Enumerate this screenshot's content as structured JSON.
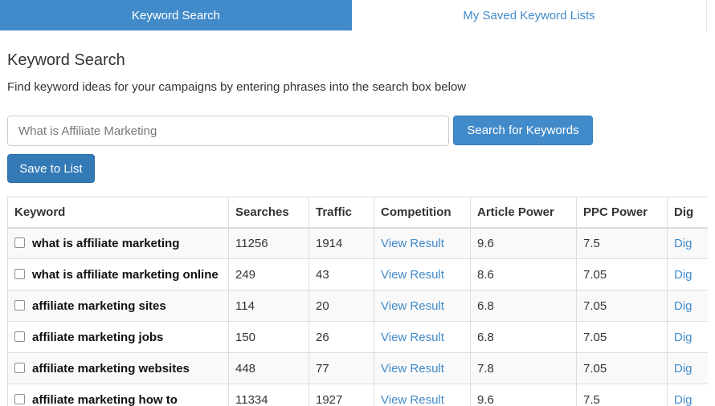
{
  "tabs": [
    {
      "label": "Keyword Search",
      "active": true
    },
    {
      "label": "My Saved Keyword Lists",
      "active": false
    }
  ],
  "page": {
    "title": "Keyword Search",
    "description": "Find keyword ideas for your campaigns by entering phrases into the search box below"
  },
  "search": {
    "placeholder": "What is Affiliate Marketing",
    "value": "",
    "button_label": "Search for Keywords"
  },
  "save_button_label": "Save to List",
  "table": {
    "headers": [
      "Keyword",
      "Searches",
      "Traffic",
      "Competition",
      "Article Power",
      "PPC Power",
      "Dig"
    ],
    "rows": [
      {
        "keyword": "what is affiliate marketing",
        "searches": "11256",
        "traffic": "1914",
        "competition": "View Result",
        "article_power": "9.6",
        "ppc_power": "7.5",
        "dig": "Dig"
      },
      {
        "keyword": "what is affiliate marketing online",
        "searches": "249",
        "traffic": "43",
        "competition": "View Result",
        "article_power": "8.6",
        "ppc_power": "7.05",
        "dig": "Dig"
      },
      {
        "keyword": "affiliate marketing sites",
        "searches": "114",
        "traffic": "20",
        "competition": "View Result",
        "article_power": "6.8",
        "ppc_power": "7.05",
        "dig": "Dig"
      },
      {
        "keyword": "affiliate marketing jobs",
        "searches": "150",
        "traffic": "26",
        "competition": "View Result",
        "article_power": "6.8",
        "ppc_power": "7.05",
        "dig": "Dig"
      },
      {
        "keyword": "affiliate marketing websites",
        "searches": "448",
        "traffic": "77",
        "competition": "View Result",
        "article_power": "7.8",
        "ppc_power": "7.05",
        "dig": "Dig"
      },
      {
        "keyword": "affiliate marketing how to",
        "searches": "11334",
        "traffic": "1927",
        "competition": "View Result",
        "article_power": "9.6",
        "ppc_power": "7.5",
        "dig": "Dig"
      }
    ]
  },
  "colors": {
    "primary": "#428bca",
    "link": "#428bca",
    "stripe": "#f9f9f9",
    "border": "#dddddd"
  }
}
